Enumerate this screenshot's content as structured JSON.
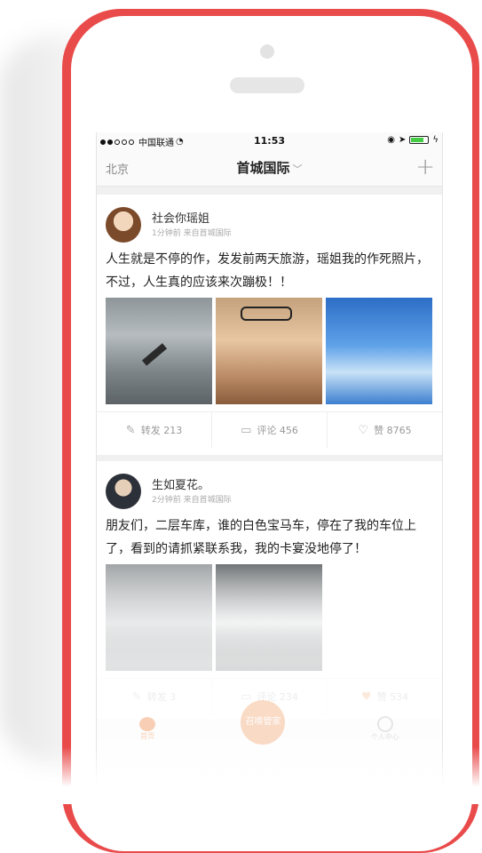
{
  "statusbar": {
    "carrier": "中国联通",
    "time": "11:53"
  },
  "navbar": {
    "city": "北京",
    "title": "首城国际",
    "plus_icon": "plus-icon"
  },
  "posts": [
    {
      "name": "社会你瑶姐",
      "meta": "1分钟前  来自首城国际",
      "text": "人生就是不停的作，发发前两天旅游，瑶姐我的作死照片，不过，人生真的应该来次蹦极！！",
      "photos": [
        "bungee-photo",
        "selfie-photo",
        "skydiving-photo"
      ],
      "actions": {
        "repost": "转发 213",
        "comment": "评论 456",
        "like": "赞 8765"
      }
    },
    {
      "name": "生如夏花。",
      "meta": "2分钟前  来自首城国际",
      "text": "朋友们，二层车库，谁的白色宝马车，停在了我的车位上了，看到的请抓紧联系我，我的卡宴没地停了！",
      "photos": [
        "white-car-photo",
        "porsche-photo"
      ],
      "actions": {
        "repost": "转发 3",
        "comment": "评论 234",
        "like": "赞 534"
      }
    }
  ],
  "tabbar": {
    "left": "首页",
    "center": "召唤管家",
    "right": "个人中心"
  },
  "colors": {
    "phone": "#e94a4a",
    "accent": "#f07a30",
    "like": "#f08a4a"
  }
}
